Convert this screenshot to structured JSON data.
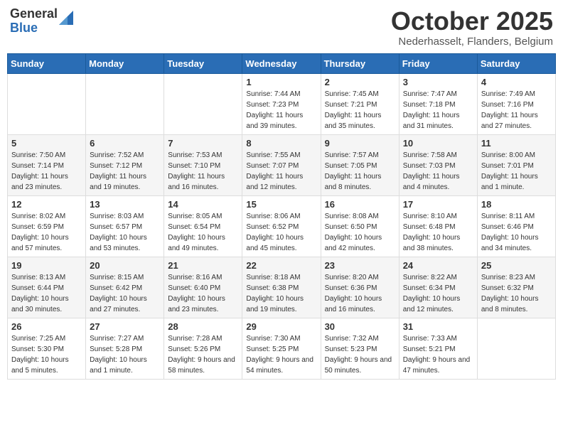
{
  "header": {
    "logo_general": "General",
    "logo_blue": "Blue",
    "month_title": "October 2025",
    "subtitle": "Nederhasselt, Flanders, Belgium"
  },
  "days_of_week": [
    "Sunday",
    "Monday",
    "Tuesday",
    "Wednesday",
    "Thursday",
    "Friday",
    "Saturday"
  ],
  "weeks": [
    [
      {
        "day": "",
        "info": ""
      },
      {
        "day": "",
        "info": ""
      },
      {
        "day": "",
        "info": ""
      },
      {
        "day": "1",
        "info": "Sunrise: 7:44 AM\nSunset: 7:23 PM\nDaylight: 11 hours and 39 minutes."
      },
      {
        "day": "2",
        "info": "Sunrise: 7:45 AM\nSunset: 7:21 PM\nDaylight: 11 hours and 35 minutes."
      },
      {
        "day": "3",
        "info": "Sunrise: 7:47 AM\nSunset: 7:18 PM\nDaylight: 11 hours and 31 minutes."
      },
      {
        "day": "4",
        "info": "Sunrise: 7:49 AM\nSunset: 7:16 PM\nDaylight: 11 hours and 27 minutes."
      }
    ],
    [
      {
        "day": "5",
        "info": "Sunrise: 7:50 AM\nSunset: 7:14 PM\nDaylight: 11 hours and 23 minutes."
      },
      {
        "day": "6",
        "info": "Sunrise: 7:52 AM\nSunset: 7:12 PM\nDaylight: 11 hours and 19 minutes."
      },
      {
        "day": "7",
        "info": "Sunrise: 7:53 AM\nSunset: 7:10 PM\nDaylight: 11 hours and 16 minutes."
      },
      {
        "day": "8",
        "info": "Sunrise: 7:55 AM\nSunset: 7:07 PM\nDaylight: 11 hours and 12 minutes."
      },
      {
        "day": "9",
        "info": "Sunrise: 7:57 AM\nSunset: 7:05 PM\nDaylight: 11 hours and 8 minutes."
      },
      {
        "day": "10",
        "info": "Sunrise: 7:58 AM\nSunset: 7:03 PM\nDaylight: 11 hours and 4 minutes."
      },
      {
        "day": "11",
        "info": "Sunrise: 8:00 AM\nSunset: 7:01 PM\nDaylight: 11 hours and 1 minute."
      }
    ],
    [
      {
        "day": "12",
        "info": "Sunrise: 8:02 AM\nSunset: 6:59 PM\nDaylight: 10 hours and 57 minutes."
      },
      {
        "day": "13",
        "info": "Sunrise: 8:03 AM\nSunset: 6:57 PM\nDaylight: 10 hours and 53 minutes."
      },
      {
        "day": "14",
        "info": "Sunrise: 8:05 AM\nSunset: 6:54 PM\nDaylight: 10 hours and 49 minutes."
      },
      {
        "day": "15",
        "info": "Sunrise: 8:06 AM\nSunset: 6:52 PM\nDaylight: 10 hours and 45 minutes."
      },
      {
        "day": "16",
        "info": "Sunrise: 8:08 AM\nSunset: 6:50 PM\nDaylight: 10 hours and 42 minutes."
      },
      {
        "day": "17",
        "info": "Sunrise: 8:10 AM\nSunset: 6:48 PM\nDaylight: 10 hours and 38 minutes."
      },
      {
        "day": "18",
        "info": "Sunrise: 8:11 AM\nSunset: 6:46 PM\nDaylight: 10 hours and 34 minutes."
      }
    ],
    [
      {
        "day": "19",
        "info": "Sunrise: 8:13 AM\nSunset: 6:44 PM\nDaylight: 10 hours and 30 minutes."
      },
      {
        "day": "20",
        "info": "Sunrise: 8:15 AM\nSunset: 6:42 PM\nDaylight: 10 hours and 27 minutes."
      },
      {
        "day": "21",
        "info": "Sunrise: 8:16 AM\nSunset: 6:40 PM\nDaylight: 10 hours and 23 minutes."
      },
      {
        "day": "22",
        "info": "Sunrise: 8:18 AM\nSunset: 6:38 PM\nDaylight: 10 hours and 19 minutes."
      },
      {
        "day": "23",
        "info": "Sunrise: 8:20 AM\nSunset: 6:36 PM\nDaylight: 10 hours and 16 minutes."
      },
      {
        "day": "24",
        "info": "Sunrise: 8:22 AM\nSunset: 6:34 PM\nDaylight: 10 hours and 12 minutes."
      },
      {
        "day": "25",
        "info": "Sunrise: 8:23 AM\nSunset: 6:32 PM\nDaylight: 10 hours and 8 minutes."
      }
    ],
    [
      {
        "day": "26",
        "info": "Sunrise: 7:25 AM\nSunset: 5:30 PM\nDaylight: 10 hours and 5 minutes."
      },
      {
        "day": "27",
        "info": "Sunrise: 7:27 AM\nSunset: 5:28 PM\nDaylight: 10 hours and 1 minute."
      },
      {
        "day": "28",
        "info": "Sunrise: 7:28 AM\nSunset: 5:26 PM\nDaylight: 9 hours and 58 minutes."
      },
      {
        "day": "29",
        "info": "Sunrise: 7:30 AM\nSunset: 5:25 PM\nDaylight: 9 hours and 54 minutes."
      },
      {
        "day": "30",
        "info": "Sunrise: 7:32 AM\nSunset: 5:23 PM\nDaylight: 9 hours and 50 minutes."
      },
      {
        "day": "31",
        "info": "Sunrise: 7:33 AM\nSunset: 5:21 PM\nDaylight: 9 hours and 47 minutes."
      },
      {
        "day": "",
        "info": ""
      }
    ]
  ]
}
